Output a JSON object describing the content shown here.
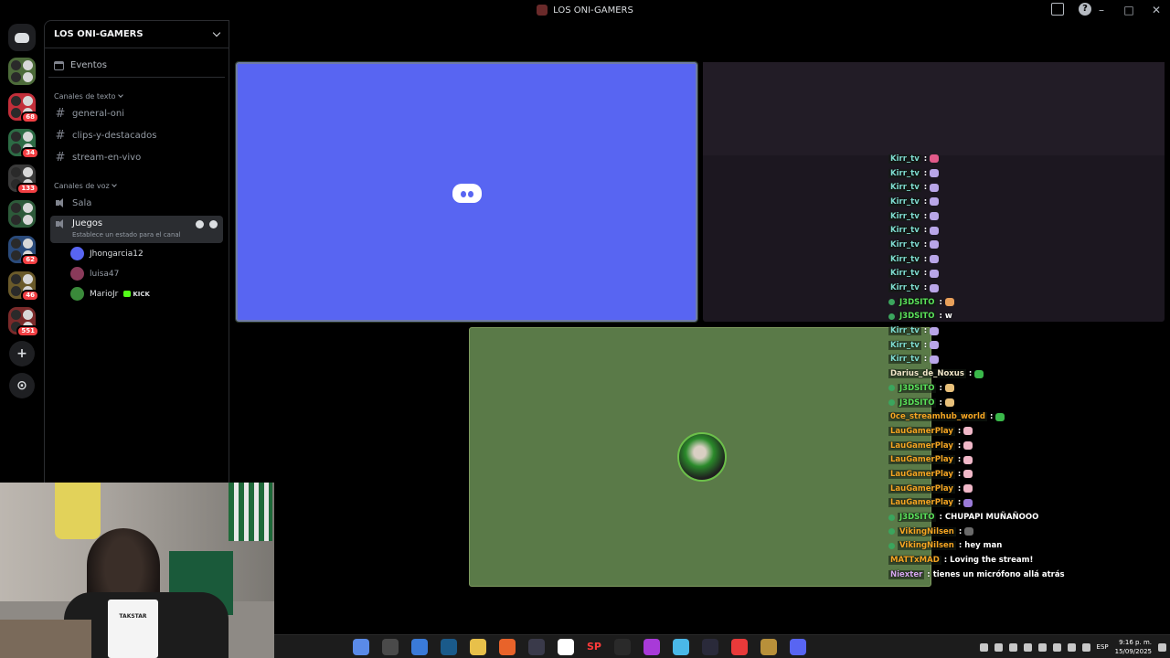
{
  "window": {
    "title": "LOS ONI-GAMERS"
  },
  "rail": {
    "servers": [
      {
        "color": "#4d6b3a",
        "badge": ""
      },
      {
        "color": "#c22f3a",
        "badge": "68"
      },
      {
        "color": "#2d6b45",
        "badge": "34"
      },
      {
        "color": "#3a3a3a",
        "badge": "133"
      },
      {
        "color": "#2d5a3a",
        "badge": ""
      },
      {
        "color": "#2a4a7a",
        "badge": "62"
      },
      {
        "color": "#6a5a2a",
        "badge": "46"
      },
      {
        "color": "#7a2a2a",
        "badge": "551"
      }
    ],
    "add_glyph": "+",
    "explore_glyph": "⊙"
  },
  "sidebar": {
    "server_name": "LOS ONI-GAMERS",
    "events_label": "Eventos",
    "text_category": "Canales de texto",
    "text_channels": [
      "general-oni",
      "clips-y-destacados",
      "stream-en-vivo"
    ],
    "voice_category": "Canales de voz",
    "voice_channels": [
      "Sala"
    ],
    "active_voice": {
      "name": "Juegos",
      "status_hint": "Establece un estado para el canal"
    },
    "members": [
      {
        "name": "Jhongarcia12",
        "color": "#5865f2"
      },
      {
        "name": "luisa47",
        "color": "#8a3a5a"
      },
      {
        "name": "MarioJr",
        "color": "#3a8a3a",
        "badge": "KICK"
      }
    ]
  },
  "chat": {
    "messages": [
      {
        "name": "Kirr_tv",
        "color": "#7fdcd0",
        "text": "",
        "emoji": "#e25a8a"
      },
      {
        "name": "Kirr_tv",
        "color": "#7fdcd0",
        "text": "",
        "emoji": "#b9a6e8"
      },
      {
        "name": "Kirr_tv",
        "color": "#7fdcd0",
        "text": "",
        "emoji": "#b9a6e8"
      },
      {
        "name": "Kirr_tv",
        "color": "#7fdcd0",
        "text": "",
        "emoji": "#b9a6e8"
      },
      {
        "name": "Kirr_tv",
        "color": "#7fdcd0",
        "text": "",
        "emoji": "#b9a6e8"
      },
      {
        "name": "Kirr_tv",
        "color": "#7fdcd0",
        "text": "",
        "emoji": "#b9a6e8"
      },
      {
        "name": "Kirr_tv",
        "color": "#7fdcd0",
        "text": "",
        "emoji": "#b9a6e8"
      },
      {
        "name": "Kirr_tv",
        "color": "#7fdcd0",
        "text": "",
        "emoji": "#b9a6e8"
      },
      {
        "name": "Kirr_tv",
        "color": "#7fdcd0",
        "text": "",
        "emoji": "#b9a6e8"
      },
      {
        "name": "Kirr_tv",
        "color": "#7fdcd0",
        "text": "",
        "emoji": "#b9a6e8"
      },
      {
        "name": "J3DSITO",
        "color": "#5be35b",
        "verified": true,
        "text": "",
        "emoji": "#e8a05a"
      },
      {
        "name": "J3DSITO",
        "color": "#5be35b",
        "verified": true,
        "text": "w",
        "emoji": ""
      },
      {
        "name": "Kirr_tv",
        "color": "#7fdcd0",
        "text": "",
        "emoji": "#b9a6e8"
      },
      {
        "name": "Kirr_tv",
        "color": "#7fdcd0",
        "text": "",
        "emoji": "#b9a6e8"
      },
      {
        "name": "Kirr_tv",
        "color": "#7fdcd0",
        "text": "",
        "emoji": "#b9a6e8"
      },
      {
        "name": "Darius_de_Noxus",
        "color": "#f0e6c8",
        "text": "",
        "emoji": "#3ab84a"
      },
      {
        "name": "J3DSITO",
        "color": "#5be35b",
        "verified": true,
        "text": "",
        "emoji": "#e8c07a"
      },
      {
        "name": "J3DSITO",
        "color": "#5be35b",
        "verified": true,
        "text": "",
        "emoji": "#e8c07a"
      },
      {
        "name": "0ce_streamhub_world",
        "color": "#f5a623",
        "text": "",
        "emoji": "#3ab84a"
      },
      {
        "name": "LauGamerPlay",
        "color": "#f5a623",
        "text": "",
        "emoji": "#f0b8c8"
      },
      {
        "name": "LauGamerPlay",
        "color": "#f5a623",
        "text": "",
        "emoji": "#f0b8c8"
      },
      {
        "name": "LauGamerPlay",
        "color": "#f5a623",
        "text": "",
        "emoji": "#f0b8c8"
      },
      {
        "name": "LauGamerPlay",
        "color": "#f5a623",
        "text": "",
        "emoji": "#f0b8c8"
      },
      {
        "name": "LauGamerPlay",
        "color": "#f5a623",
        "text": "",
        "emoji": "#f0b8c8"
      },
      {
        "name": "LauGamerPlay",
        "color": "#f5a623",
        "text": "",
        "emoji": "#9a7ad8"
      },
      {
        "name": "J3DSITO",
        "color": "#5be35b",
        "verified": true,
        "text": "CHUPAPI MUÑAÑOOO",
        "emoji": ""
      },
      {
        "name": "VikingNilsen",
        "color": "#f5a623",
        "verified": true,
        "text": "",
        "emoji": "#6a6a6a"
      },
      {
        "name": "VikingNilsen",
        "color": "#f5a623",
        "verified": true,
        "text": "hey man",
        "emoji": ""
      },
      {
        "name": "MATTxMAD",
        "color": "#f5a623",
        "text": "Loving the stream!",
        "emoji": ""
      },
      {
        "name": "Niexter",
        "color": "#d6a8f0",
        "text": "tienes un micrófono allá atrás",
        "emoji": ""
      }
    ]
  },
  "webcam": {
    "mic_label": "TAKSTAR"
  },
  "taskbar": {
    "apps": [
      {
        "name": "copilot-app",
        "color": "#5a8ae8"
      },
      {
        "name": "settings-app",
        "color": "#4a4a4a"
      },
      {
        "name": "store-app",
        "color": "#3a7ad8"
      },
      {
        "name": "league-app",
        "color": "#1a5a8a"
      },
      {
        "name": "explorer-app",
        "color": "#e8c04a"
      },
      {
        "name": "brave-app",
        "color": "#e8632a"
      },
      {
        "name": "steam-app",
        "color": "#3a3a4a"
      },
      {
        "name": "whatsapp-app",
        "color": "#ffffff"
      },
      {
        "name": "sp-app",
        "label": "SP"
      },
      {
        "name": "riot-app",
        "color": "#2a2a2a"
      },
      {
        "name": "xbox-app",
        "color": "#a83ad8"
      },
      {
        "name": "chrome-app",
        "color": "#4ab8e8"
      },
      {
        "name": "steam2-app",
        "color": "#2a2a3a"
      },
      {
        "name": "riotclient-app",
        "color": "#e83a3a"
      },
      {
        "name": "lol-app",
        "color": "#b8903a"
      },
      {
        "name": "discord-app",
        "color": "#5865f2"
      }
    ],
    "lang": "ESP",
    "time": "9:16 p. m.",
    "date": "15/09/2025"
  }
}
